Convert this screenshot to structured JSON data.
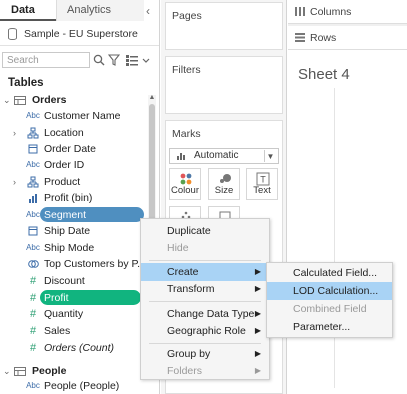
{
  "left_pane": {
    "tabs": {
      "data": "Data",
      "analytics": "Analytics"
    },
    "datasource": "Sample - EU Superstore",
    "search_placeholder": "Search",
    "tables_header": "Tables",
    "tables": [
      {
        "name": "Orders",
        "fields": [
          {
            "type": "Abc",
            "label": "Customer Name",
            "kind": "dim"
          },
          {
            "type": "geo",
            "label": "Location",
            "kind": "dim",
            "expandable": true
          },
          {
            "type": "date",
            "label": "Order Date",
            "kind": "dim"
          },
          {
            "type": "Abc",
            "label": "Order ID",
            "kind": "dim"
          },
          {
            "type": "hier",
            "label": "Product",
            "kind": "dim",
            "expandable": true
          },
          {
            "type": "bin",
            "label": "Profit (bin)",
            "kind": "dim"
          },
          {
            "type": "Abc",
            "label": "Segment",
            "kind": "dim",
            "selected": true
          },
          {
            "type": "date",
            "label": "Ship Date",
            "kind": "dim"
          },
          {
            "type": "Abc",
            "label": "Ship Mode",
            "kind": "dim"
          },
          {
            "type": "set",
            "label": "Top Customers by P...",
            "kind": "dim"
          },
          {
            "type": "#",
            "label": "Discount",
            "kind": "mea"
          },
          {
            "type": "#",
            "label": "Profit",
            "kind": "mea",
            "selected": true
          },
          {
            "type": "#",
            "label": "Quantity",
            "kind": "mea"
          },
          {
            "type": "#",
            "label": "Sales",
            "kind": "mea"
          },
          {
            "type": "#",
            "label": "Orders (Count)",
            "kind": "mea",
            "italic": true
          }
        ]
      },
      {
        "name": "People",
        "fields": [
          {
            "type": "Abc",
            "label": "People (People)",
            "kind": "dim"
          }
        ]
      }
    ]
  },
  "cards": {
    "pages": "Pages",
    "filters": "Filters",
    "marks": "Marks",
    "marks_type": "Automatic",
    "marks_buttons": [
      "Colour",
      "Size",
      "Text"
    ]
  },
  "shelves": {
    "columns": "Columns",
    "rows": "Rows"
  },
  "sheet_title": "Sheet 4",
  "context_menu": {
    "items": [
      "Duplicate",
      "Hide",
      "Create",
      "Transform",
      "Change Data Type",
      "Geographic Role",
      "Group by",
      "Folders"
    ]
  },
  "create_submenu": {
    "items": [
      "Calculated Field...",
      "LOD Calculation...",
      "Combined Field",
      "Parameter..."
    ]
  },
  "colors": {
    "dimension": "#3c6ca8",
    "measure": "#2c9f73",
    "segment_pill": "#4f8fc0",
    "profit_pill": "#11b47f",
    "menu_highlight": "#a9d3f5"
  }
}
